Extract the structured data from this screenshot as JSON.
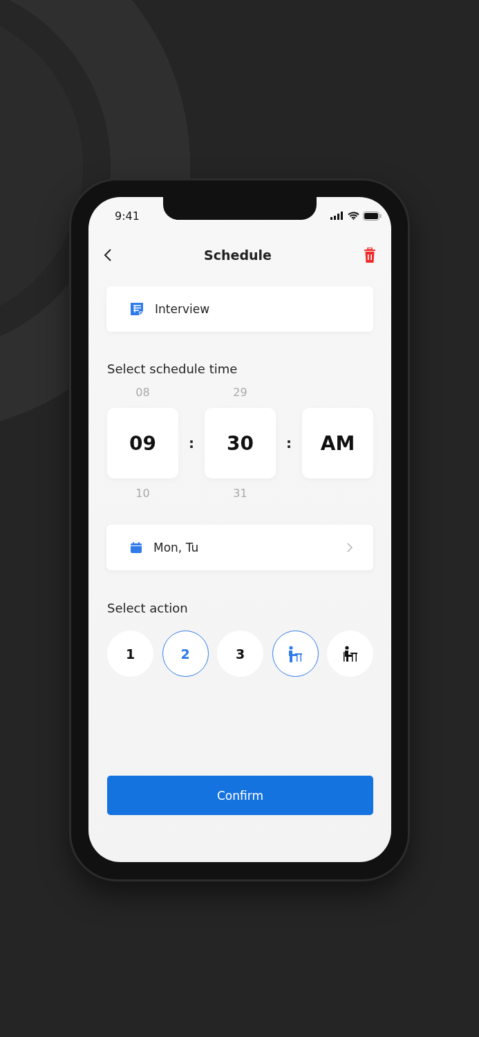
{
  "status_bar": {
    "time": "9:41"
  },
  "header": {
    "title": "Schedule"
  },
  "event": {
    "title": "Interview"
  },
  "time_section": {
    "label": "Select schedule time",
    "columns": [
      {
        "above": "08",
        "value": "09",
        "below": "10"
      },
      {
        "above": "29",
        "value": "30",
        "below": "31"
      },
      {
        "value": "AM"
      }
    ],
    "separator": ":"
  },
  "days": {
    "value": "Mon, Tu"
  },
  "action_section": {
    "label": "Select action",
    "actions": [
      {
        "kind": "number",
        "label": "1",
        "selected": false
      },
      {
        "kind": "number",
        "label": "2",
        "selected": true
      },
      {
        "kind": "number",
        "label": "3",
        "selected": false
      },
      {
        "kind": "standing",
        "selected": true
      },
      {
        "kind": "seated",
        "selected": false
      }
    ]
  },
  "confirm_button": "Confirm"
}
